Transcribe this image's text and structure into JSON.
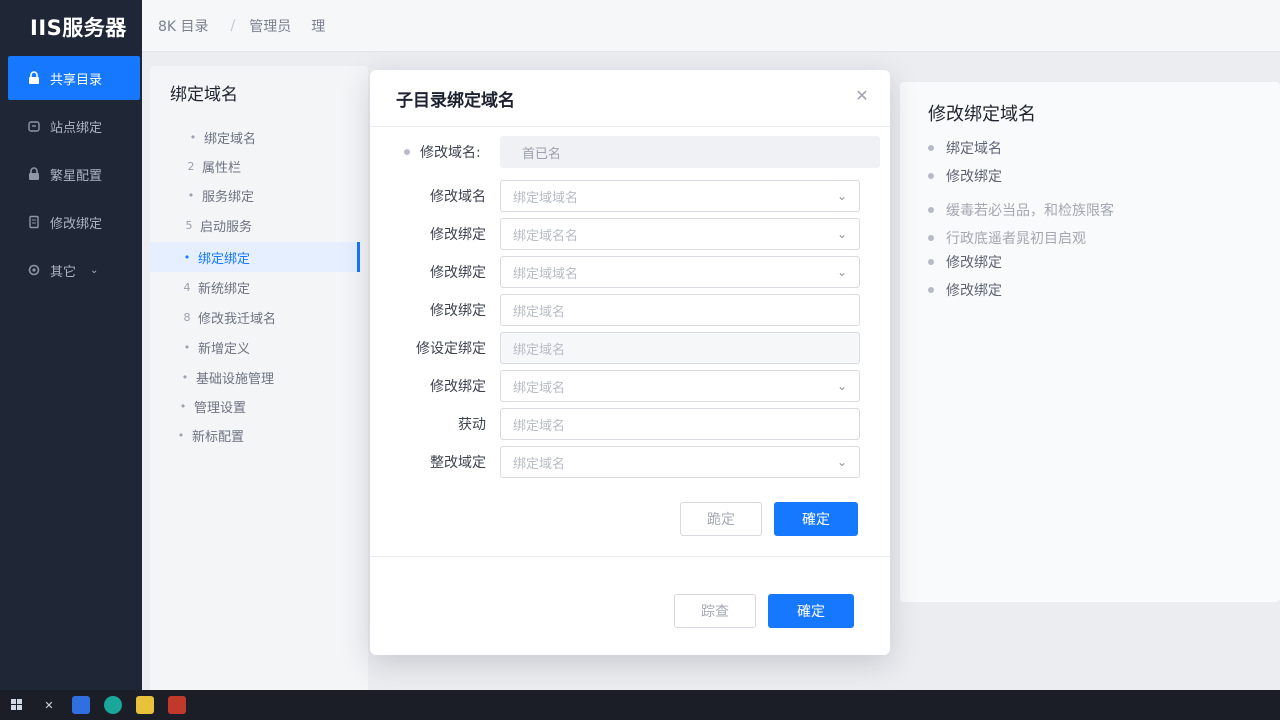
{
  "app": {
    "title": "IIS服务器"
  },
  "sidebar": {
    "items": [
      {
        "label": "共享目录",
        "icon": "lock-icon",
        "active": true
      },
      {
        "label": "站点绑定",
        "icon": "link-icon",
        "active": false
      },
      {
        "label": "繁星配置",
        "icon": "lock-icon",
        "active": false
      },
      {
        "label": "修改绑定",
        "icon": "file-icon",
        "active": false
      },
      {
        "label": "其它",
        "icon": "gear-icon",
        "active": false,
        "expandable": true
      }
    ]
  },
  "breadcrumb": {
    "items": [
      "8K 目录",
      "管理员",
      "理"
    ]
  },
  "tree": {
    "title": "绑定域名",
    "items": [
      {
        "marker": "•",
        "label": "绑定域名"
      },
      {
        "marker": "2",
        "label": "属性栏"
      },
      {
        "marker": "•",
        "label": "服务绑定"
      },
      {
        "marker": "5",
        "label": "启动服务"
      },
      {
        "marker": "•",
        "label": "绑定绑定",
        "active": true
      },
      {
        "marker": "4",
        "label": "新统绑定"
      },
      {
        "marker": "8",
        "label": "修改我迁域名"
      },
      {
        "marker": "•",
        "label": "新增定义"
      },
      {
        "marker": "•",
        "label": "基础设施管理"
      },
      {
        "marker": "•",
        "label": "管理设置"
      },
      {
        "marker": "•",
        "label": "新标配置"
      }
    ]
  },
  "modal": {
    "title": "子目录绑定域名",
    "readonly": {
      "label": "修改域名:",
      "value": "首已名"
    },
    "fields": [
      {
        "label": "修改域名",
        "placeholder": "绑定域域名",
        "select": true,
        "disabled": false
      },
      {
        "label": "修改绑定",
        "placeholder": "绑定域名名",
        "select": true,
        "disabled": false
      },
      {
        "label": "修改绑定",
        "placeholder": "绑定域域名",
        "select": true,
        "disabled": false
      },
      {
        "label": "修改绑定",
        "placeholder": "绑定域名",
        "select": false,
        "disabled": false
      },
      {
        "label": "修设定绑定",
        "placeholder": "绑定域名",
        "select": false,
        "disabled": true
      },
      {
        "label": "修改绑定",
        "placeholder": "绑定域名",
        "select": true,
        "disabled": false
      },
      {
        "label": "获动",
        "placeholder": "绑定域名",
        "select": false,
        "disabled": false
      },
      {
        "label": "整改域定",
        "placeholder": "绑定域名",
        "select": true,
        "disabled": false
      }
    ],
    "inner_buttons": {
      "cancel": "跪定",
      "confirm": "確定"
    },
    "footer_buttons": {
      "cancel": "踪查",
      "confirm": "確定"
    }
  },
  "info_panel": {
    "title": "修改绑定域名",
    "items": [
      {
        "text": "绑定域名",
        "faded": false
      },
      {
        "text": "修改绑定",
        "faded": false
      },
      {
        "text": "缓毒若必当品，和检族限客",
        "faded": true
      },
      {
        "text": "行政底遥者晁初目启观",
        "faded": true
      },
      {
        "text": "修改绑定",
        "faded": false
      },
      {
        "text": "修改绑定",
        "faded": false
      }
    ]
  },
  "colors": {
    "accent": "#1677ff",
    "sidebar_bg": "#1f2635"
  }
}
